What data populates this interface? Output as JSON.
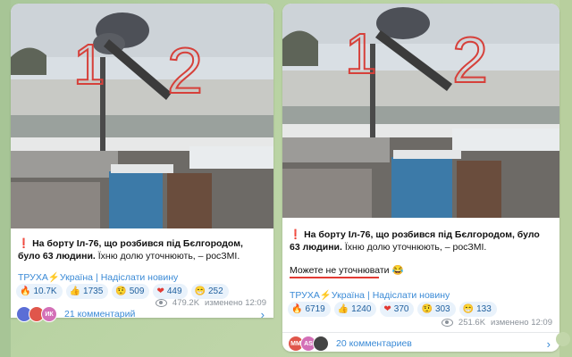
{
  "colors": {
    "accent": "#3a8ad6",
    "exclamation": "#e0262d",
    "underline": "#e23a33",
    "bg": "#b9d3a3"
  },
  "post_left": {
    "caption_bold": "На борту Іл-76, що розбився під Бєлгородом, було 63 людини.",
    "caption_rest": " Їхню долю уточнюють, – росЗМІ.",
    "channel": "ТРУХА⚡Україна",
    "suggest": "Надіслати новину",
    "reactions": [
      {
        "icon": "fire-icon",
        "glyph": "🔥",
        "count": "10.7K"
      },
      {
        "icon": "thumbs-up-icon",
        "glyph": "👍",
        "count": "1735"
      },
      {
        "icon": "grimace-face-icon",
        "glyph": "🤨",
        "count": "509"
      },
      {
        "icon": "heart-icon",
        "glyph": "❤",
        "count": "449"
      },
      {
        "icon": "grin-face-icon",
        "glyph": "😁",
        "count": "252"
      }
    ],
    "views": "479.2K",
    "edited": "изменено 12:09",
    "comments": "21 комментарий",
    "avatars": [
      {
        "t": "",
        "c": "#5b6ed6"
      },
      {
        "t": "",
        "c": "#e0564b"
      },
      {
        "t": "ИК",
        "c": "#d36fb7"
      }
    ]
  },
  "post_right": {
    "caption_bold": "На борту Іл-76, що розбився під Бєлгородом, було 63 людини.",
    "caption_rest": " Їхню долю уточнюють, – росЗМІ.",
    "note": "Можете не уточнювати 😂",
    "channel": "ТРУХА⚡Україна",
    "suggest": "Надіслати новину",
    "reactions": [
      {
        "icon": "fire-icon",
        "glyph": "🔥",
        "count": "6719"
      },
      {
        "icon": "thumbs-up-icon",
        "glyph": "👍",
        "count": "1240"
      },
      {
        "icon": "heart-icon",
        "glyph": "❤",
        "count": "370"
      },
      {
        "icon": "grimace-face-icon",
        "glyph": "🤨",
        "count": "303"
      },
      {
        "icon": "grin-face-icon",
        "glyph": "😁",
        "count": "133"
      }
    ],
    "views": "251.6K",
    "edited": "изменено 12:09",
    "comments": "20 комментариев",
    "avatars": [
      {
        "t": "MM",
        "c": "#e0564b"
      },
      {
        "t": "AS",
        "c": "#d36fb7"
      },
      {
        "t": "",
        "c": "#444"
      }
    ]
  },
  "overlay_numbers": {
    "one": "1",
    "two": "2"
  }
}
